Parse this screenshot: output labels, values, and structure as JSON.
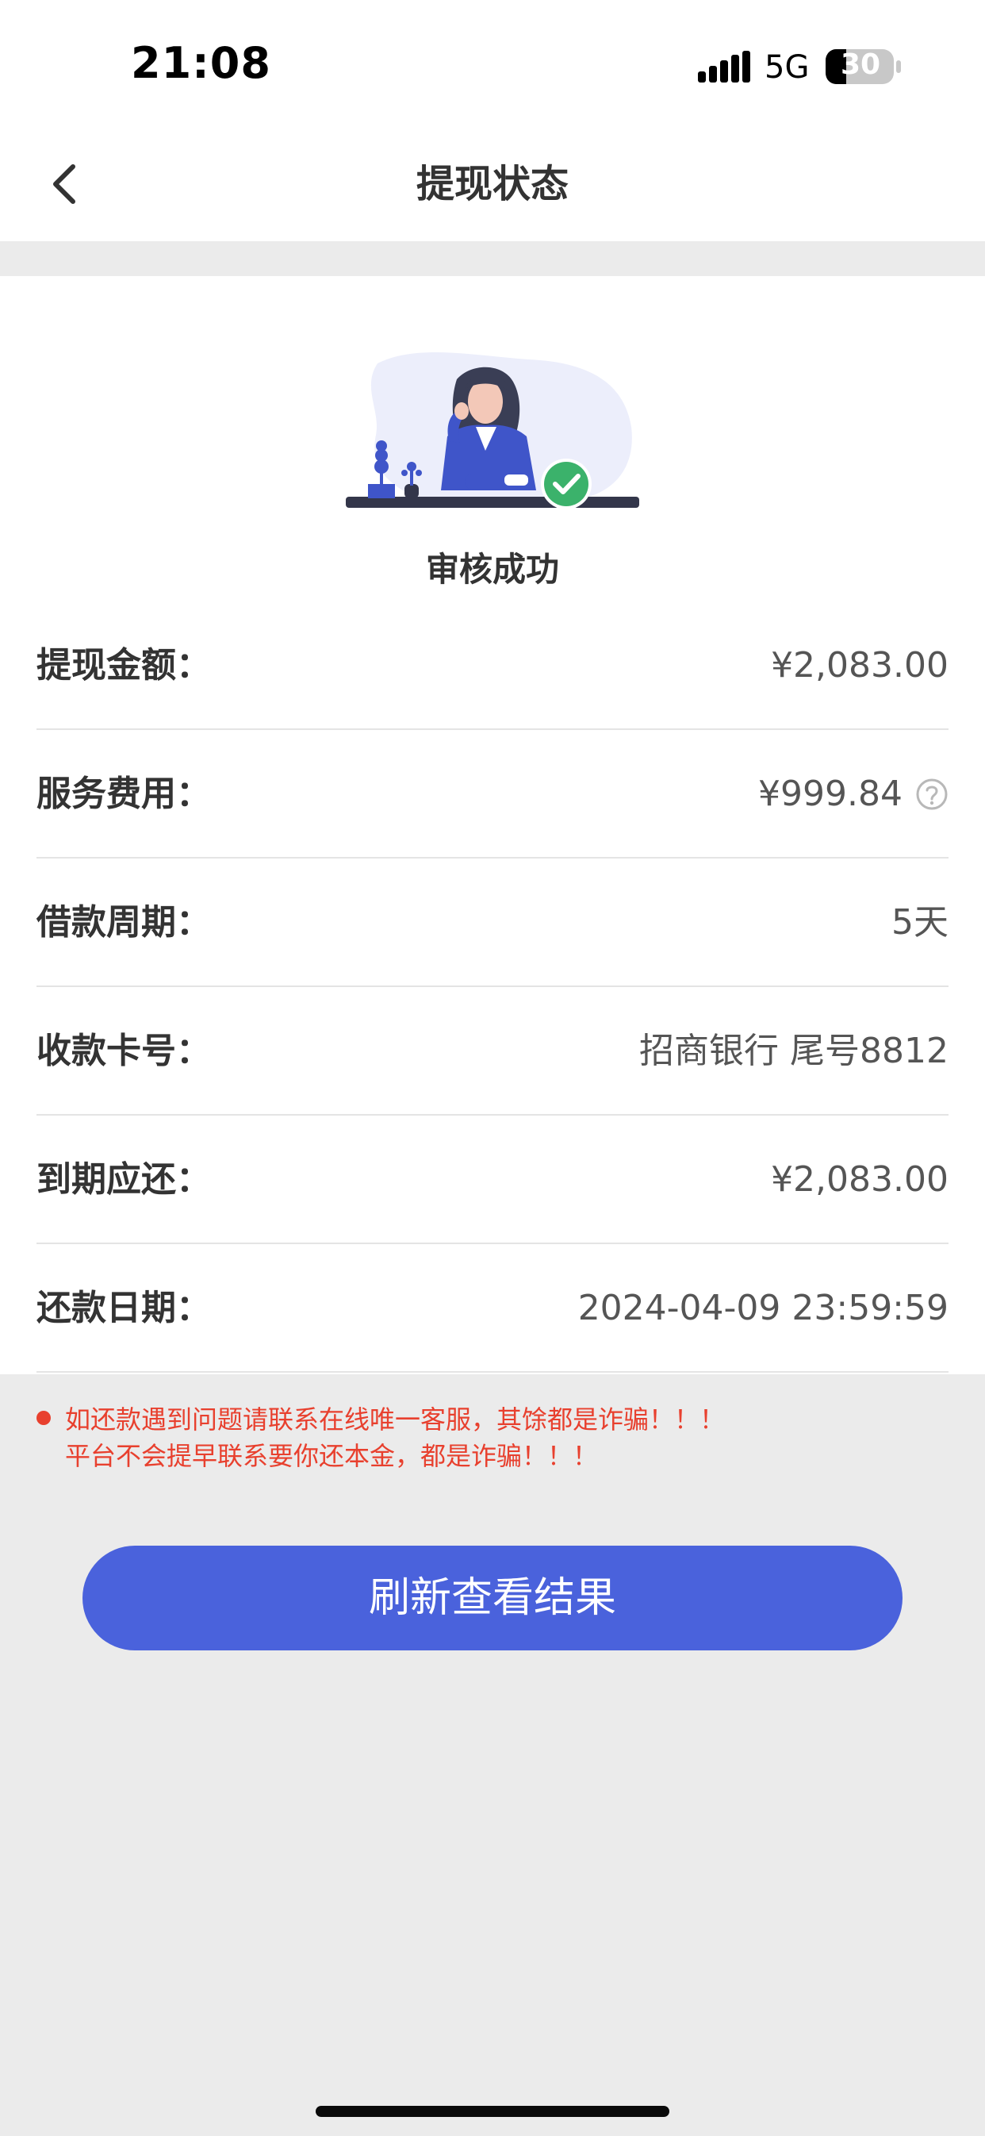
{
  "status_bar": {
    "time": "21:08",
    "network": "5G",
    "battery": "30",
    "icons": [
      "signal-icon",
      "battery-icon"
    ]
  },
  "nav": {
    "title": "提现状态",
    "back_icon": "chevron-left-icon"
  },
  "status": {
    "title": "审核成功",
    "illustration": "woman-at-desk-success-illustration",
    "accent_color": "#4a62dc",
    "success_color": "#3bb26b"
  },
  "details": [
    {
      "label": "提现金额：",
      "value": "¥2,083.00"
    },
    {
      "label": "服务费用：",
      "value": "¥999.84",
      "help_icon": "question-circle-icon"
    },
    {
      "label": "借款周期：",
      "value": "5天"
    },
    {
      "label": "收款卡号：",
      "value": "招商银行 尾号8812"
    },
    {
      "label": "到期应还：",
      "value": "¥2,083.00"
    },
    {
      "label": "还款日期：",
      "value": "2024-04-09 23:59:59"
    }
  ],
  "notice": {
    "lines": [
      "如还款遇到问题请联系在线唯一客服，其馀都是诈骗！！！",
      "平台不会提早联系要你还本金，都是诈骗！！！"
    ],
    "color": "#e8402e"
  },
  "refresh_button": {
    "label": "刷新查看结果",
    "color": "#4a62dc"
  }
}
